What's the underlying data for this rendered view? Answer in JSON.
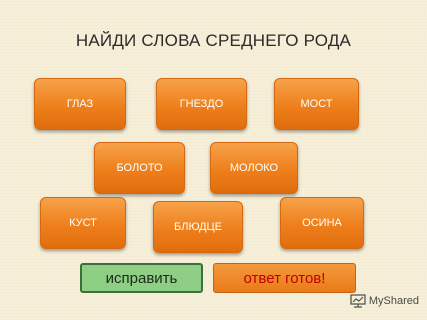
{
  "title": "НАЙДИ СЛОВА СРЕДНЕГО РОДА",
  "words": [
    {
      "label": "ГЛАЗ"
    },
    {
      "label": "ГНЕЗДО"
    },
    {
      "label": "МОСТ"
    },
    {
      "label": "БОЛОТО"
    },
    {
      "label": "МОЛОКО"
    },
    {
      "label": "КУСТ"
    },
    {
      "label": "БЛЮДЦЕ"
    },
    {
      "label": "ОСИНА"
    }
  ],
  "buttons": {
    "fix": "исправить",
    "ready": "ответ готов!"
  },
  "watermark": {
    "text": "MyShared",
    "icon": "presentation-icon"
  }
}
